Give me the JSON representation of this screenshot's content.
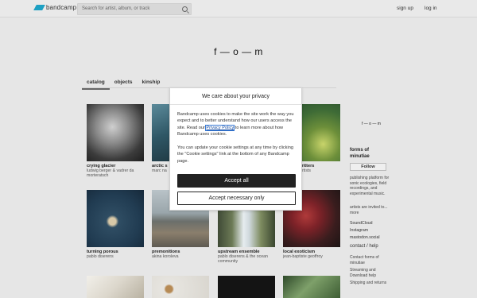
{
  "header": {
    "logo_text": "bandcamp",
    "search_placeholder": "Search for artist, album, or track",
    "signup": "sign up",
    "login": "log in",
    "accent": "#1da0c3"
  },
  "band": {
    "title": "f — o — m"
  },
  "tabs": [
    {
      "label": "catalog"
    },
    {
      "label": "objects"
    },
    {
      "label": "kinship"
    }
  ],
  "albums": [
    {
      "title": "crying glacier",
      "artist": "ludwig berger & vadrer da morteratsch"
    },
    {
      "title": "arctic s",
      "artist": "marc na"
    },
    {
      "title": "",
      "artist": ""
    },
    {
      "title": "ng critters",
      "artist": "rtists"
    },
    {
      "title": "turning porous",
      "artist": "pablo diserens"
    },
    {
      "title": "premonitions",
      "artist": "akina koroleva"
    },
    {
      "title": "upstream ensemble",
      "artist": "pablo diserens & the ocean community"
    },
    {
      "title": "local exoticism",
      "artist": "jean-baptiste geoffroy"
    }
  ],
  "sidebar": {
    "logo": "f — o — m",
    "name": "forms of minutiae",
    "follow": "Follow",
    "description": "publishing platform for sonic ecologies, field recordings, and experimental music.",
    "invite": "artists are invited to...",
    "invite_more": "more",
    "links": [
      "SoundCloud",
      "Instagram",
      "mastodon.social"
    ],
    "contact_heading": "contact / help",
    "contact_links": [
      "Contact forms of minutiae",
      "Streaming and Download help",
      "Shipping and returns"
    ]
  },
  "modal": {
    "title": "We care about your privacy",
    "p1_before": "Bandcamp uses cookies to make the site work the way you expect and to better understand how our users access the site. Read our ",
    "p1_link": "Privacy Policy",
    "p1_after": " to learn more about how Bandcamp uses cookies.",
    "p2": "You can update your cookie settings at any time by clicking the \"Cookie settings\" link at the bottom of any Bandcamp page.",
    "accept_all": "Accept all",
    "accept_necessary": "Accept necessary only"
  }
}
